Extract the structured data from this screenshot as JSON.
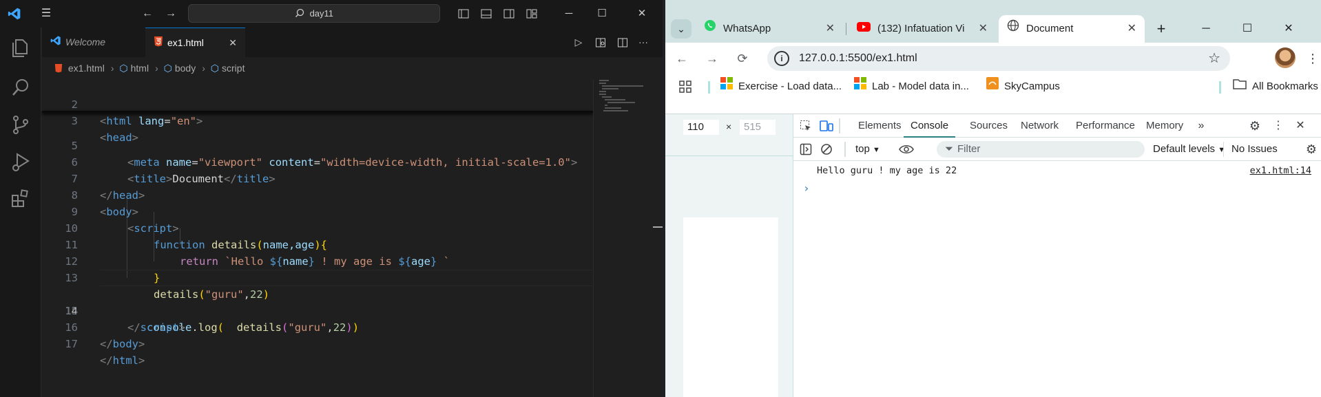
{
  "vscode": {
    "search_text": "day11",
    "tabs": [
      {
        "label": "Welcome"
      },
      {
        "label": "ex1.html"
      }
    ],
    "breadcrumb": [
      "ex1.html",
      "html",
      "body",
      "script"
    ],
    "lines": [
      {
        "num": "2"
      },
      {
        "num": "3"
      },
      {
        "num": "5"
      },
      {
        "num": "6"
      },
      {
        "num": "7"
      },
      {
        "num": "8"
      },
      {
        "num": "9"
      },
      {
        "num": "10"
      },
      {
        "num": "11"
      },
      {
        "num": "12"
      },
      {
        "num": "13"
      },
      {
        "num": "14"
      },
      {
        "num": "15"
      },
      {
        "num": "16"
      },
      {
        "num": "17"
      }
    ],
    "code": {
      "l2": {
        "open": "<",
        "tag": "html",
        "attr": "lang",
        "eq": "=",
        "val": "\"en\"",
        "close": ">"
      },
      "l3": {
        "open": "<",
        "tag": "head",
        "close": ">"
      },
      "l5": {
        "open": "<",
        "tag": "meta",
        "attr1": "name",
        "eq1": "=",
        "val1": "\"viewport\"",
        "attr2": "content",
        "eq2": "=",
        "val2": "\"width=device-width, initial-scale=1.0\"",
        "close": ">"
      },
      "l6": {
        "open": "<",
        "tag": "title",
        "close": ">",
        "text": "Document",
        "open2": "</",
        "tag2": "title",
        "close2": ">"
      },
      "l7": {
        "open": "</",
        "tag": "head",
        "close": ">"
      },
      "l8": {
        "open": "<",
        "tag": "body",
        "close": ">"
      },
      "l9": {
        "open": "<",
        "tag": "script",
        "close": ">"
      },
      "l10": {
        "kw": "function",
        "fn": "details",
        "p1": "(",
        "params": "name,age",
        "p2": ")",
        "b": "{"
      },
      "l11": {
        "kw": "return",
        "tpl1": "`Hello ",
        "d1": "${",
        "v1": "name",
        "e1": "}",
        "tpl2": " ! my age is ",
        "d2": "${",
        "v2": "age",
        "e2": "}",
        "tpl3": " `"
      },
      "l12": {
        "b": "}"
      },
      "l13": {
        "fn": "details",
        "p1": "(",
        "str": "\"guru\"",
        "comma": ",",
        "num": "22",
        "p2": ")"
      },
      "l14": {
        "obj": "console",
        "dot": ".",
        "fn": "log",
        "p1": "(",
        "sp": "  ",
        "fn2": "details",
        "p3": "(",
        "str": "\"guru\"",
        "comma": ",",
        "num": "22",
        "p4": ")",
        "p2": ")"
      },
      "l15": {
        "open": "</",
        "tag": "script",
        "close": ">"
      },
      "l16": {
        "open": "</",
        "tag": "body",
        "close": ">"
      },
      "l17": {
        "open": "</",
        "tag": "html",
        "close": ">"
      }
    }
  },
  "chrome": {
    "tabs": [
      {
        "label": "WhatsApp"
      },
      {
        "label": "(132) Infatuation Vi"
      },
      {
        "label": "Document"
      }
    ],
    "url": "127.0.0.1:5500/ex1.html",
    "bookmarks": [
      "Exercise - Load data...",
      "Lab - Model data in...",
      "SkyCampus",
      "All Bookmarks"
    ],
    "devtools": {
      "viewport_width": "110",
      "viewport_height": "515",
      "viewport_x": "×",
      "tabs": [
        "Elements",
        "Console",
        "Sources",
        "Network",
        "Performance",
        "Memory"
      ],
      "context": "top",
      "filter_placeholder": "Filter",
      "levels": "Default levels",
      "issues": "No Issues",
      "log_message": "Hello guru ! my age is 22",
      "log_source": "ex1.html:14"
    }
  }
}
